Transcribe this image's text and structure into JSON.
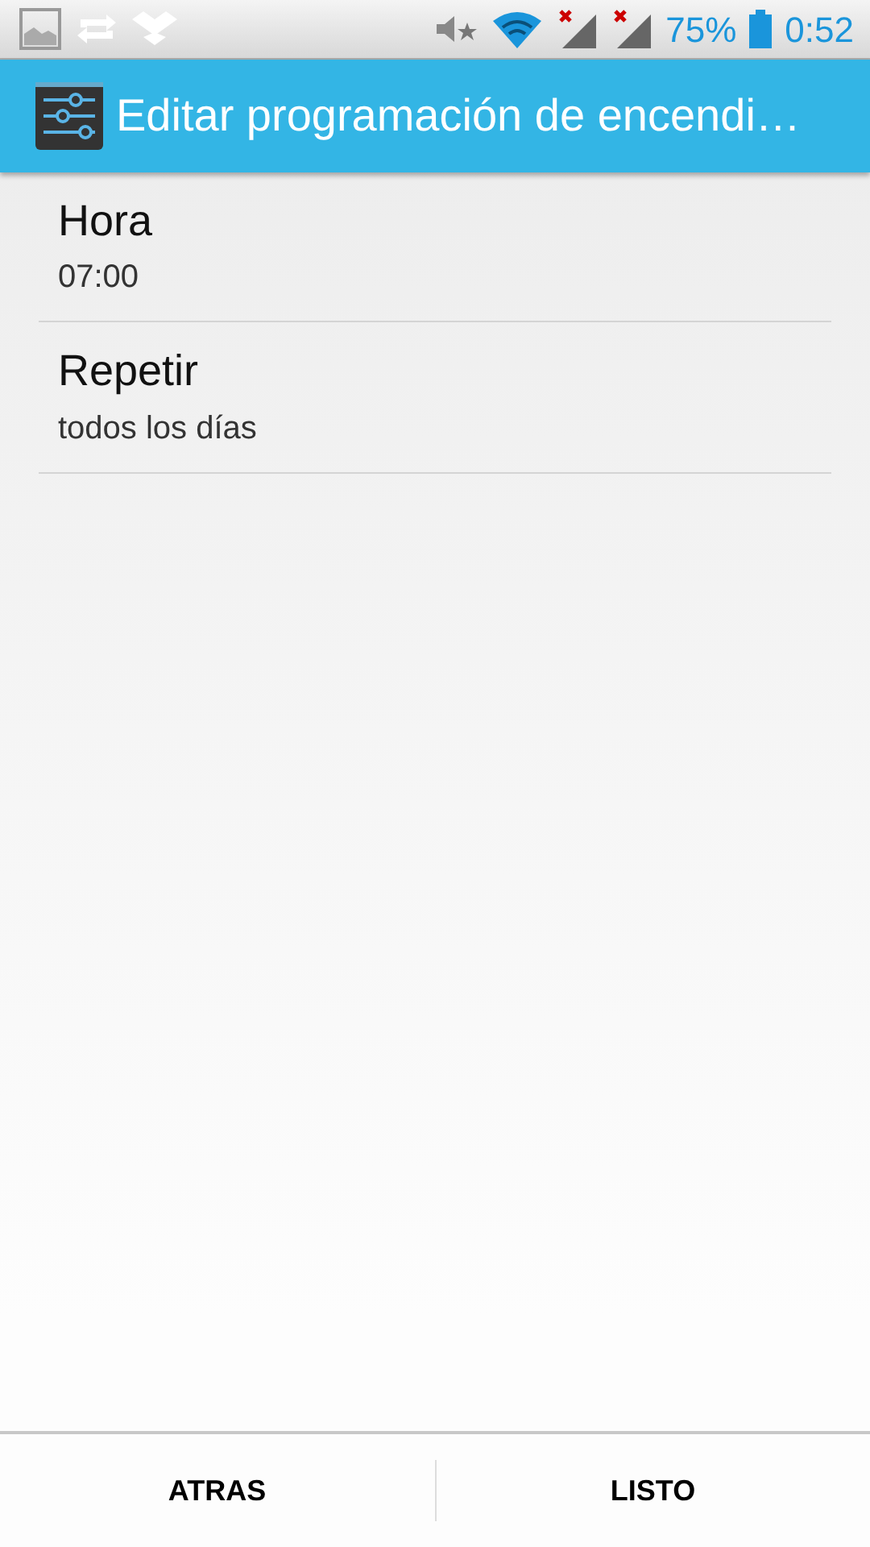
{
  "status_bar": {
    "battery_percent": "75%",
    "time": "0:52"
  },
  "action_bar": {
    "title": "Editar programación de encendi…"
  },
  "settings": [
    {
      "title": "Hora",
      "summary": "07:00"
    },
    {
      "title": "Repetir",
      "summary": "todos los días"
    }
  ],
  "buttons": [
    "ATRAS",
    "LISTO"
  ]
}
